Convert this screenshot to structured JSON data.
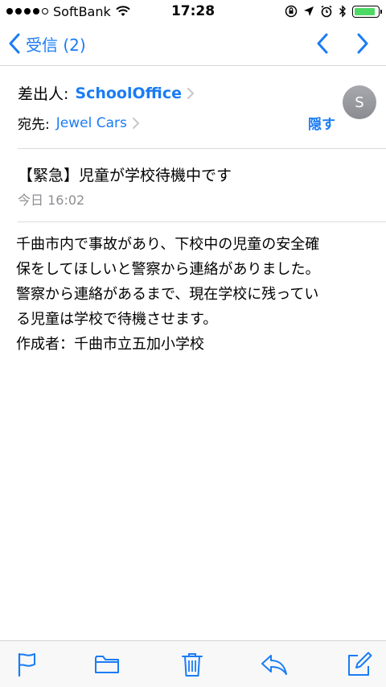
{
  "status_bar": {
    "carrier": "SoftBank",
    "time": "17:28",
    "battery_level": 0.9
  },
  "nav": {
    "back_label": "受信 (2)"
  },
  "header": {
    "from_label": "差出人:",
    "from_value": "SchoolOffice",
    "to_label": "宛先:",
    "to_value": "Jewel Cars",
    "hide_label": "隠す",
    "avatar_initial": "S"
  },
  "message": {
    "subject": "【緊急】児童が学校待機中です",
    "date": "今日 16:02",
    "body_lines": [
      "千曲市内で事故があり、下校中の児童の安全確",
      "保をしてほしいと警察から連絡がありました。",
      "警察から連絡があるまで、現在学校に残ってい",
      "る児童は学校で待機させます。",
      "作成者：千曲市立五加小学校"
    ]
  },
  "colors": {
    "accent": "#1a7cf5",
    "secondary_text": "#8e8e93"
  },
  "toolbar": {
    "icons": [
      "flag-icon",
      "folder-icon",
      "trash-icon",
      "reply-icon",
      "compose-icon"
    ]
  }
}
